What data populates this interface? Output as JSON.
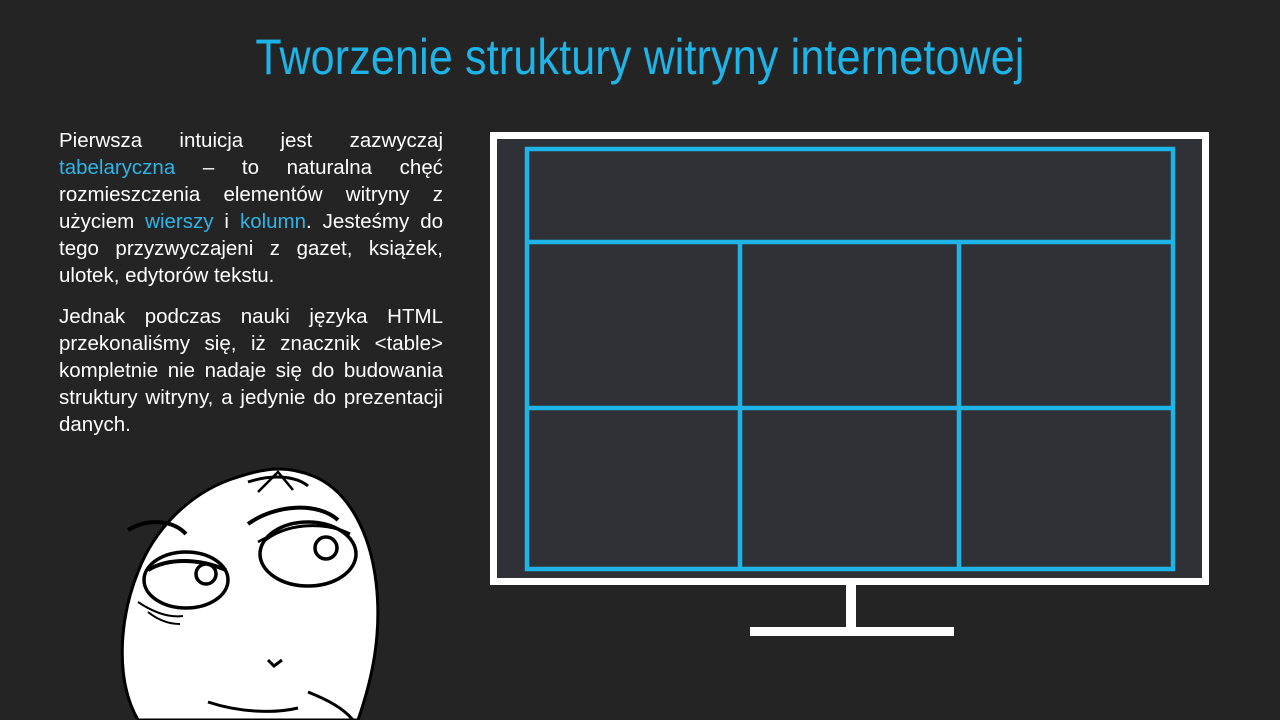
{
  "slide": {
    "title": "Tworzenie struktury witryny internetowej",
    "paragraph1": {
      "t1": "Pierwsza intuicja jest zazwyczaj ",
      "h1": "tabelaryczna",
      "t2": " – to naturalna chęć rozmieszczenia elementów witryny z użyciem ",
      "h2": "wierszy",
      "t3": " i ",
      "h3": "kolumn",
      "t4": ". Jesteśmy do tego przyzwyczajeni z gazet, książek, ulotek, edytorów tekstu."
    },
    "paragraph2": "Jednak podczas nauki języka HTML przekonaliśmy się, iż znacznik <table> kompletnie nie nadaje się do budowania struktury witryny, a jedynie do prezentacji danych."
  },
  "illustration": {
    "layout_grid": {
      "header_rows": 1,
      "body_rows": 2,
      "body_columns": 3
    },
    "meme_face": "thinking-troll-face-icon"
  },
  "colors": {
    "background": "#242424",
    "accent": "#1EB4E8",
    "text": "#FFFFFF",
    "screen": "#2F3136",
    "frame": "#FFFFFF"
  }
}
